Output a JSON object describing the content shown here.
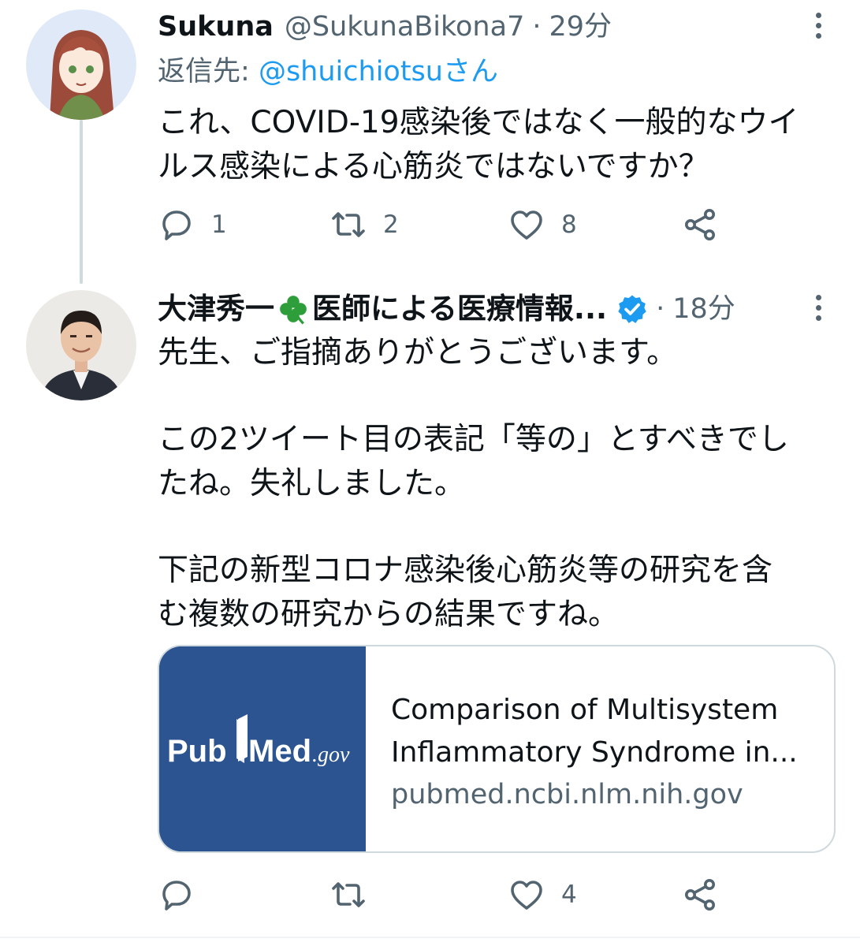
{
  "tweets": [
    {
      "display_name": "Sukuna",
      "handle": "@SukunaBikona7",
      "separator": "·",
      "time": "29分",
      "reply_to_label": "返信先:",
      "reply_to_mention": "@shuichiotsuさん",
      "text_lines": [
        "これ、COVID-19感染後ではなく一般的なウイ",
        "ルス感染による心筋炎ではないですか？"
      ],
      "counts": {
        "replies": "1",
        "retweets": "2",
        "likes": "8"
      }
    },
    {
      "display_name_part1": "大津秀一",
      "display_name_part2": "医師による医療情報...",
      "verified": true,
      "separator": "·",
      "time": "18分",
      "paragraphs": [
        [
          "先生、ご指摘ありがとうございます。"
        ],
        [
          "この2ツイート目の表記「等の」とすべきでし",
          "たね。失礼しました。"
        ],
        [
          "下記の新型コロナ感染後心筋炎等の研究を含",
          "む複数の研究からの結果ですね。"
        ]
      ],
      "link_card": {
        "thumbnail_logo": "PubMed.gov",
        "title_lines": [
          "Comparison of Multisystem",
          "Inflammatory Syndrome in..."
        ],
        "domain": "pubmed.ncbi.nlm.nih.gov"
      },
      "counts": {
        "replies": "",
        "retweets": "",
        "likes": "4"
      }
    }
  ],
  "icons": [
    "reply-icon",
    "retweet-icon",
    "like-icon",
    "share-icon",
    "more-icon",
    "verified-icon",
    "clover-icon"
  ],
  "colors": {
    "text": "#0f1419",
    "secondary": "#536471",
    "link": "#1d9bf0",
    "card_thumb_bg": "#2c5491",
    "clover": "#2e9e3a"
  }
}
